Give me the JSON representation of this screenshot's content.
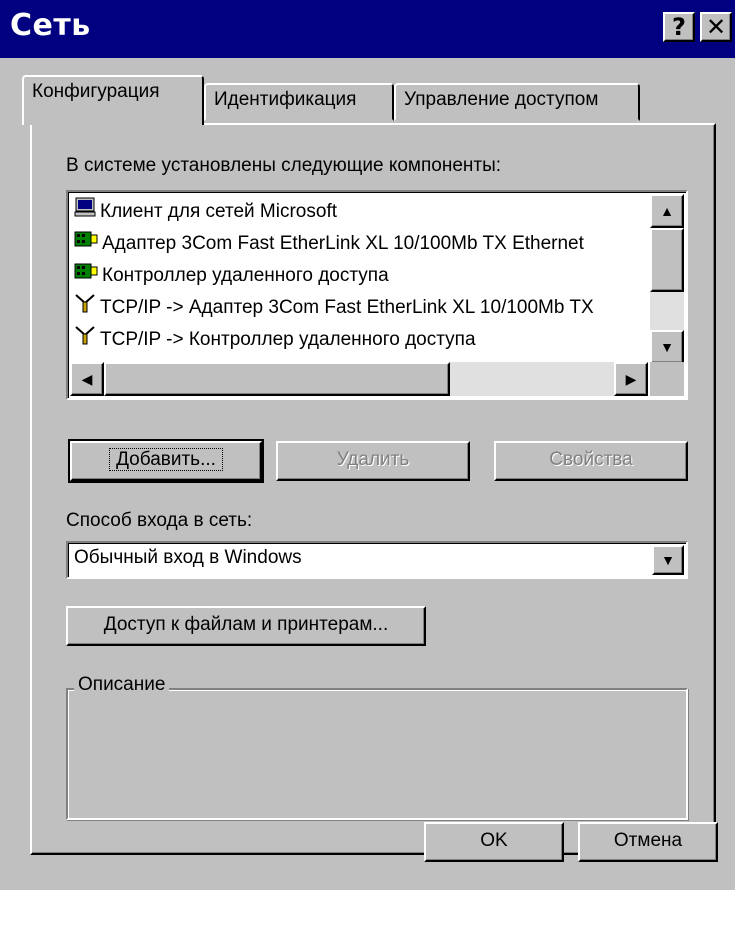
{
  "window": {
    "title": "Сеть",
    "help_glyph": "?",
    "close_glyph": "✕"
  },
  "tabs": [
    {
      "label": "Конфигурация"
    },
    {
      "label": "Идентификация"
    },
    {
      "label": "Управление доступом"
    }
  ],
  "components": {
    "label": "В системе установлены следующие компоненты:",
    "items": [
      {
        "label": "Клиент для сетей Microsoft",
        "icon": "network-client-icon"
      },
      {
        "label": "Адаптер 3Com Fast EtherLink XL 10/100Mb TX Ethernet",
        "icon": "network-adapter-icon"
      },
      {
        "label": "Контроллер удаленного доступа",
        "icon": "network-adapter-icon"
      },
      {
        "label": "TCP/IP -> Адаптер 3Com Fast EtherLink XL 10/100Mb TX",
        "icon": "protocol-icon"
      },
      {
        "label": "TCP/IP -> Контроллер удаленного доступа",
        "icon": "protocol-icon"
      }
    ]
  },
  "buttons": {
    "add": "Добавить...",
    "remove": "Удалить",
    "properties": "Свойства",
    "file_print": "Доступ к файлам и принтерам...",
    "ok": "OK",
    "cancel": "Отмена"
  },
  "logon": {
    "label": "Способ входа в сеть:",
    "value": "Обычный вход в Windows"
  },
  "description": {
    "label": "Описание"
  },
  "colors": {
    "titlebar": "#000080",
    "face": "#c0c0c0"
  }
}
